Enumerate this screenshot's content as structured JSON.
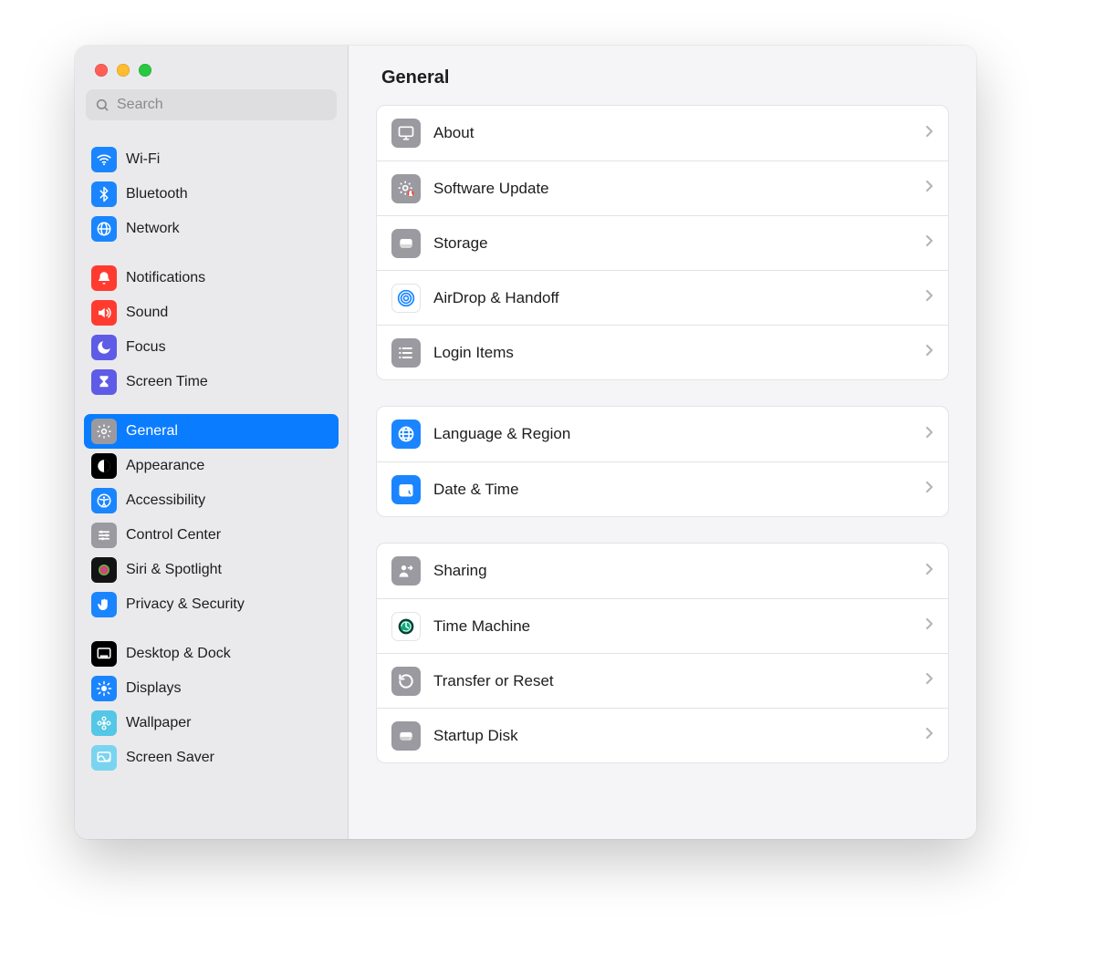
{
  "window": {
    "traffic_lights": [
      "close",
      "minimize",
      "zoom"
    ]
  },
  "sidebar": {
    "search_placeholder": "Search",
    "groups": [
      {
        "items": [
          {
            "id": "wifi",
            "label": "Wi-Fi",
            "icon": "wifi-icon",
            "bg": "#1a85ff",
            "fg": "#ffffff"
          },
          {
            "id": "bluetooth",
            "label": "Bluetooth",
            "icon": "bluetooth-icon",
            "bg": "#1a85ff",
            "fg": "#ffffff"
          },
          {
            "id": "network",
            "label": "Network",
            "icon": "network-icon",
            "bg": "#1a85ff",
            "fg": "#ffffff"
          }
        ]
      },
      {
        "items": [
          {
            "id": "notifications",
            "label": "Notifications",
            "icon": "bell-icon",
            "bg": "#ff3b30",
            "fg": "#ffffff"
          },
          {
            "id": "sound",
            "label": "Sound",
            "icon": "speaker-icon",
            "bg": "#ff3b30",
            "fg": "#ffffff"
          },
          {
            "id": "focus",
            "label": "Focus",
            "icon": "moon-icon",
            "bg": "#5e5ce6",
            "fg": "#ffffff"
          },
          {
            "id": "screen-time",
            "label": "Screen Time",
            "icon": "hourglass-icon",
            "bg": "#5e5ce6",
            "fg": "#ffffff"
          }
        ]
      },
      {
        "items": [
          {
            "id": "general",
            "label": "General",
            "icon": "gear-icon",
            "bg": "#9a9aa0",
            "fg": "#ffffff",
            "selected": true
          },
          {
            "id": "appearance",
            "label": "Appearance",
            "icon": "appearance-icon",
            "bg": "#000000",
            "fg": "#ffffff"
          },
          {
            "id": "accessibility",
            "label": "Accessibility",
            "icon": "accessibility-icon",
            "bg": "#1a85ff",
            "fg": "#ffffff"
          },
          {
            "id": "control-center",
            "label": "Control Center",
            "icon": "switches-icon",
            "bg": "#9a9aa0",
            "fg": "#ffffff"
          },
          {
            "id": "siri-and-spotlight",
            "label": "Siri & Spotlight",
            "icon": "siri-icon",
            "bg": "#131316",
            "fg": "#ffffff"
          },
          {
            "id": "privacy-and-security",
            "label": "Privacy & Security",
            "icon": "hand-icon",
            "bg": "#1a85ff",
            "fg": "#ffffff"
          }
        ]
      },
      {
        "items": [
          {
            "id": "desktop-and-dock",
            "label": "Desktop & Dock",
            "icon": "dock-icon",
            "bg": "#000000",
            "fg": "#ffffff"
          },
          {
            "id": "displays",
            "label": "Displays",
            "icon": "brightness-icon",
            "bg": "#1a85ff",
            "fg": "#ffffff"
          },
          {
            "id": "wallpaper",
            "label": "Wallpaper",
            "icon": "flower-icon",
            "bg": "#55c7e6",
            "fg": "#ffffff"
          },
          {
            "id": "screen-saver",
            "label": "Screen Saver",
            "icon": "screensaver-icon",
            "bg": "#7ad4f0",
            "fg": "#ffffff"
          }
        ]
      }
    ]
  },
  "main": {
    "title": "General",
    "sections": [
      {
        "rows": [
          {
            "id": "about",
            "label": "About",
            "icon": "display-icon",
            "bg": "#9a9aa0",
            "fg": "#ffffff"
          },
          {
            "id": "software-update",
            "label": "Software Update",
            "icon": "gear-badge-icon",
            "bg": "#9a9aa0",
            "fg": "#ffffff"
          },
          {
            "id": "storage",
            "label": "Storage",
            "icon": "disk-icon",
            "bg": "#9a9aa0",
            "fg": "#ffffff"
          },
          {
            "id": "airdrop-handoff",
            "label": "AirDrop & Handoff",
            "icon": "airdrop-icon",
            "bg": "#ffffff",
            "fg": "#1a85ff",
            "border": "#e3e3e5"
          },
          {
            "id": "login-items",
            "label": "Login Items",
            "icon": "list-icon",
            "bg": "#9a9aa0",
            "fg": "#ffffff"
          }
        ]
      },
      {
        "rows": [
          {
            "id": "language-region",
            "label": "Language & Region",
            "icon": "globe-icon",
            "bg": "#1a85ff",
            "fg": "#ffffff"
          },
          {
            "id": "date-time",
            "label": "Date & Time",
            "icon": "calendar-clock-icon",
            "bg": "#1a85ff",
            "fg": "#ffffff"
          }
        ]
      },
      {
        "rows": [
          {
            "id": "sharing",
            "label": "Sharing",
            "icon": "person-arrow-icon",
            "bg": "#9a9aa0",
            "fg": "#ffffff"
          },
          {
            "id": "time-machine",
            "label": "Time Machine",
            "icon": "clock-arrow-icon",
            "bg": "#ffffff",
            "fg": "#0f766e",
            "border": "#e3e3e5"
          },
          {
            "id": "transfer-reset",
            "label": "Transfer or Reset",
            "icon": "reset-icon",
            "bg": "#9a9aa0",
            "fg": "#ffffff"
          },
          {
            "id": "startup-disk",
            "label": "Startup Disk",
            "icon": "startup-disk-icon",
            "bg": "#9a9aa0",
            "fg": "#ffffff"
          }
        ]
      }
    ]
  }
}
